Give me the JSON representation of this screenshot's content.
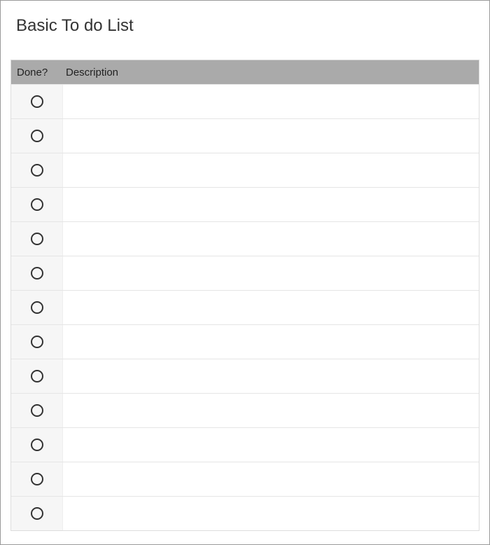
{
  "title": "Basic To do List",
  "columns": {
    "done": "Done?",
    "description": "Description"
  },
  "rows": [
    {
      "done": false,
      "description": ""
    },
    {
      "done": false,
      "description": ""
    },
    {
      "done": false,
      "description": ""
    },
    {
      "done": false,
      "description": ""
    },
    {
      "done": false,
      "description": ""
    },
    {
      "done": false,
      "description": ""
    },
    {
      "done": false,
      "description": ""
    },
    {
      "done": false,
      "description": ""
    },
    {
      "done": false,
      "description": ""
    },
    {
      "done": false,
      "description": ""
    },
    {
      "done": false,
      "description": ""
    },
    {
      "done": false,
      "description": ""
    },
    {
      "done": false,
      "description": ""
    }
  ]
}
